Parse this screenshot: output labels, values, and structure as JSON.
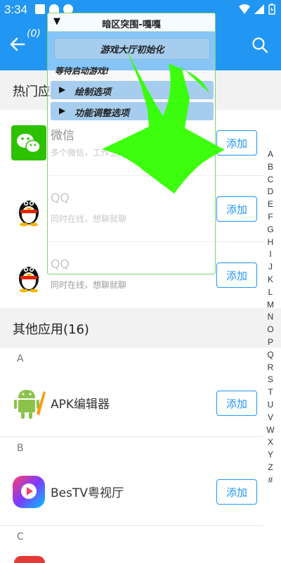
{
  "status_bar": {
    "time": "3:34"
  },
  "header": {
    "back_count": "(0)"
  },
  "hot_section": {
    "title": "热门应用"
  },
  "hot_apps": [
    {
      "name": "微信",
      "desc": "多个微信，工作生活",
      "add": "添加"
    },
    {
      "name": "QQ",
      "desc": "同时在线，想聊就聊",
      "add": "添加"
    },
    {
      "name": "QQ",
      "desc": "同时在线，想聊就聊",
      "add": "添加"
    }
  ],
  "other_section": {
    "title": "其他应用(16)"
  },
  "groups": [
    {
      "letter": "A",
      "app": {
        "name": "APK编辑器",
        "add": "添加"
      }
    },
    {
      "letter": "B",
      "app": {
        "name": "BesTV粤视厅",
        "add": "添加"
      }
    },
    {
      "letter": "C"
    }
  ],
  "alpha_index": [
    "A",
    "B",
    "C",
    "D",
    "E",
    "F",
    "G",
    "H",
    "I",
    "J",
    "K",
    "L",
    "M",
    "N",
    "O",
    "P",
    "Q",
    "R",
    "S",
    "T",
    "U",
    "V",
    "W",
    "X",
    "Y",
    "Z",
    "#"
  ],
  "overlay": {
    "collapse_glyph": "▼",
    "title": "暗区突围-嘎嘎",
    "init_button": "游戏大厅初始化",
    "status": "等待启动游戏!",
    "sections": [
      {
        "arrow": "▶",
        "label": "绘制选项"
      },
      {
        "arrow": "▶",
        "label": "功能调整选项"
      }
    ]
  },
  "colors": {
    "accent": "#2196f3",
    "overlay_button": "#a6cdee",
    "arrow": "#33ff00"
  },
  "icons": [
    "back-arrow-icon",
    "search-icon",
    "wechat-icon",
    "qq-penguin-icon",
    "android-apk-icon",
    "bestv-icon",
    "collapse-triangle-icon",
    "expand-triangle-icon",
    "green-down-arrow-icon"
  ]
}
